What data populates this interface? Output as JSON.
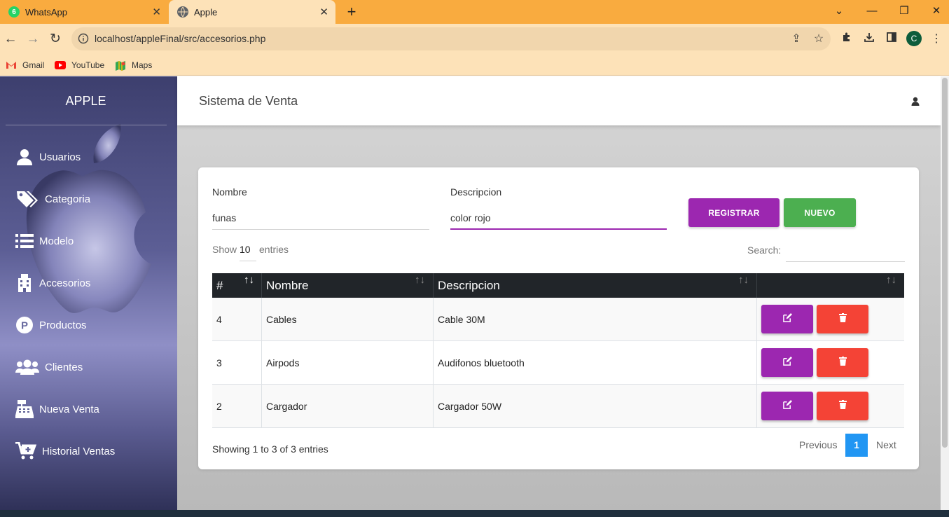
{
  "browser": {
    "tabs": [
      {
        "label": "WhatsApp",
        "badge": "6"
      },
      {
        "label": "Apple"
      }
    ],
    "new_tab": "+",
    "url": "localhost/appleFinal/src/accesorios.php",
    "profile_initial": "C",
    "bookmarks": [
      "Gmail",
      "YouTube",
      "Maps"
    ]
  },
  "sidebar": {
    "brand": "APPLE",
    "items": [
      {
        "label": "Usuarios",
        "icon": "user-icon"
      },
      {
        "label": "Categoria",
        "icon": "tags-icon"
      },
      {
        "label": "Modelo",
        "icon": "list-icon"
      },
      {
        "label": "Accesorios",
        "icon": "building-icon"
      },
      {
        "label": "Productos",
        "icon": "product-p-icon"
      },
      {
        "label": "Clientes",
        "icon": "users-icon"
      },
      {
        "label": "Nueva Venta",
        "icon": "cash-register-icon"
      },
      {
        "label": "Historial Ventas",
        "icon": "cart-plus-icon"
      }
    ]
  },
  "header": {
    "title": "Sistema de Venta"
  },
  "form": {
    "nombre_label": "Nombre",
    "nombre_value": "funas",
    "descripcion_label": "Descripcion",
    "descripcion_value": "color rojo",
    "registrar_label": "REGISTRAR",
    "nuevo_label": "NUEVO"
  },
  "datatable": {
    "show_label": "Show",
    "entries_value": "10",
    "entries_label": "entries",
    "search_label": "Search:",
    "columns": [
      "#",
      "Nombre",
      "Descripcion",
      ""
    ],
    "rows": [
      {
        "id": "4",
        "nombre": "Cables",
        "descripcion": "Cable 30M"
      },
      {
        "id": "3",
        "nombre": "Airpods",
        "descripcion": "Audifonos bluetooth"
      },
      {
        "id": "2",
        "nombre": "Cargador",
        "descripcion": "Cargador 50W"
      }
    ],
    "info": "Showing 1 to 3 of 3 entries",
    "pagination": {
      "previous": "Previous",
      "current": "1",
      "next": "Next"
    }
  },
  "colors": {
    "accent_purple": "#9c27b0",
    "success_green": "#4caf50",
    "danger_red": "#f44336",
    "page_active": "#2196f3",
    "browser_orange": "#f9ab3f"
  }
}
